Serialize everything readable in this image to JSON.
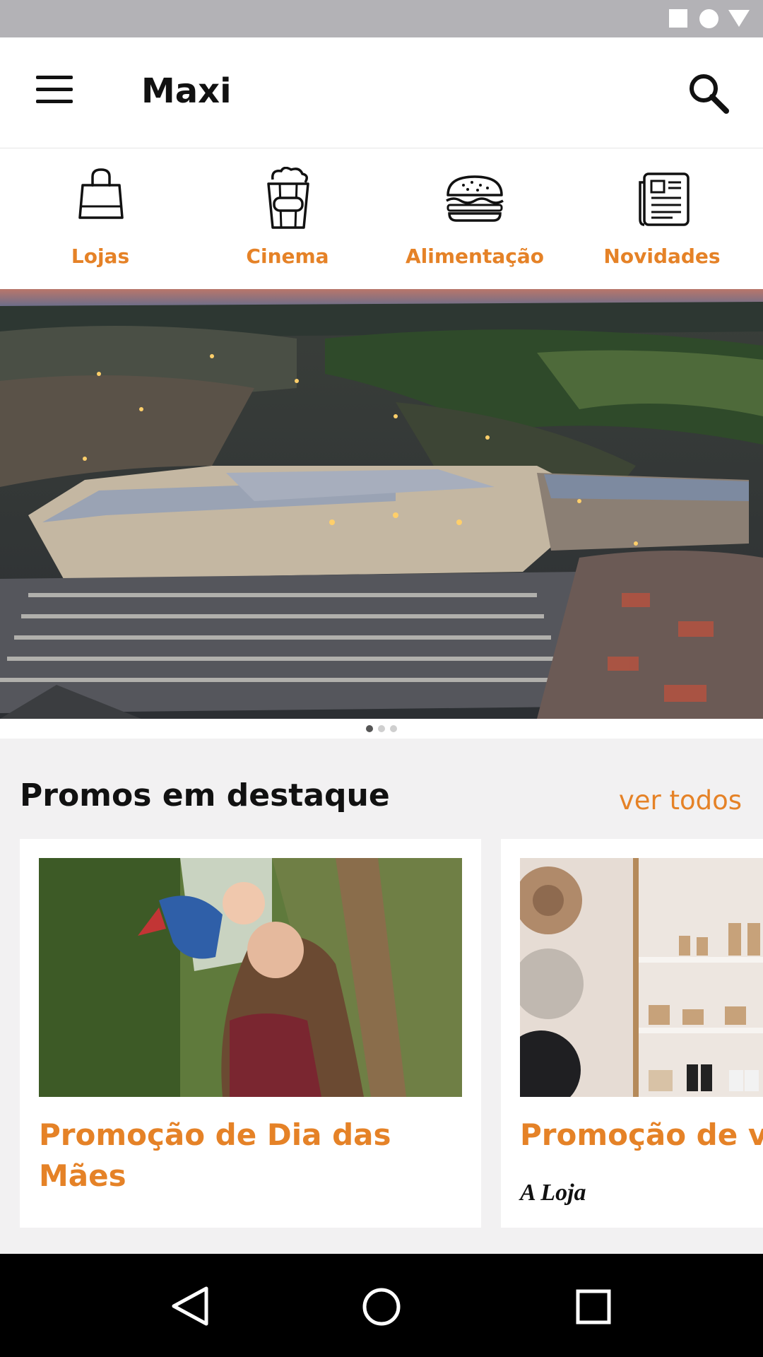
{
  "app": {
    "title": "Maxi"
  },
  "categories": [
    {
      "label": "Lojas",
      "icon": "shopping-bag-icon"
    },
    {
      "label": "Cinema",
      "icon": "popcorn-icon"
    },
    {
      "label": "Alimentação",
      "icon": "burger-icon"
    },
    {
      "label": "Novidades",
      "icon": "newspaper-icon"
    }
  ],
  "banner": {
    "slides": 3,
    "active_slide": 1
  },
  "promos": {
    "title": "Promos em destaque",
    "see_all": "ver todos",
    "items": [
      {
        "title": "Promoção de Dia das Mães",
        "store": ""
      },
      {
        "title": "Promoção de v",
        "store": "A Loja"
      }
    ]
  },
  "colors": {
    "accent": "#e58227",
    "status_bar": "#b3b2b6",
    "nav_bar": "#000000"
  }
}
